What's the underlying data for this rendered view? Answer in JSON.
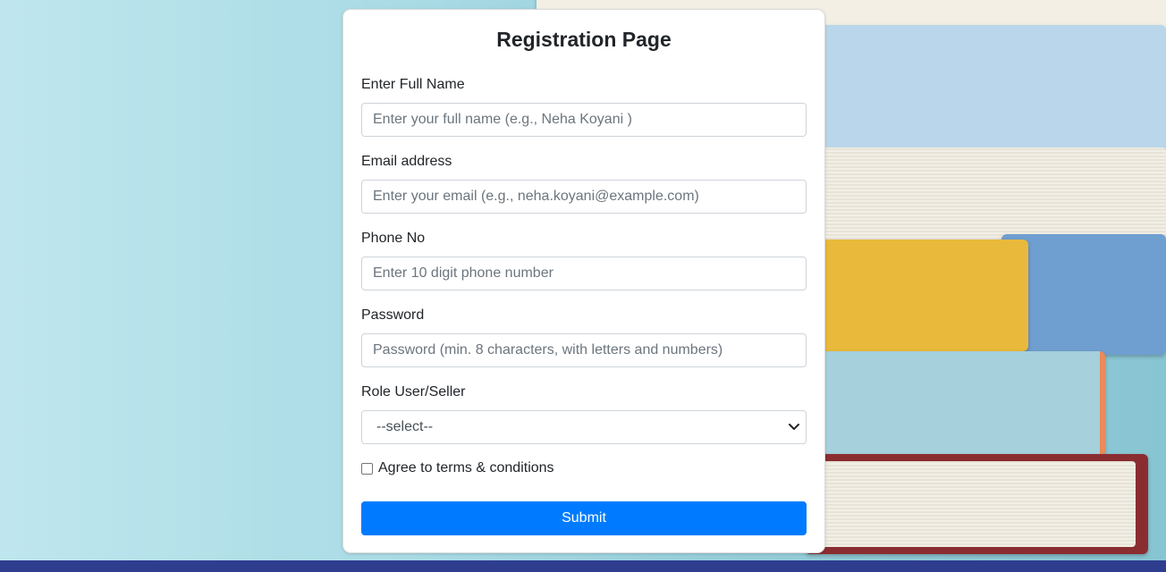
{
  "page": {
    "title": "Registration Page"
  },
  "form": {
    "full_name": {
      "label": "Enter Full Name",
      "placeholder": "Enter your full name (e.g., Neha Koyani )",
      "value": ""
    },
    "email": {
      "label": "Email address",
      "placeholder": "Enter your email (e.g., neha.koyani@example.com)",
      "value": ""
    },
    "phone": {
      "label": "Phone No",
      "placeholder": "Enter 10 digit phone number",
      "value": ""
    },
    "password": {
      "label": "Password",
      "placeholder": "Password (min. 8 characters, with letters and numbers)",
      "value": ""
    },
    "role": {
      "label": "Role User/Seller",
      "selected": "--select--"
    },
    "terms": {
      "label": "Agree to terms & conditions",
      "checked": false
    },
    "submit_label": "Submit"
  },
  "icons": {
    "select_chevron": "chevron-down-icon"
  },
  "colors": {
    "primary": "#007bff",
    "footer_bar": "#2f3d8f",
    "background": "#a9dbe5"
  }
}
